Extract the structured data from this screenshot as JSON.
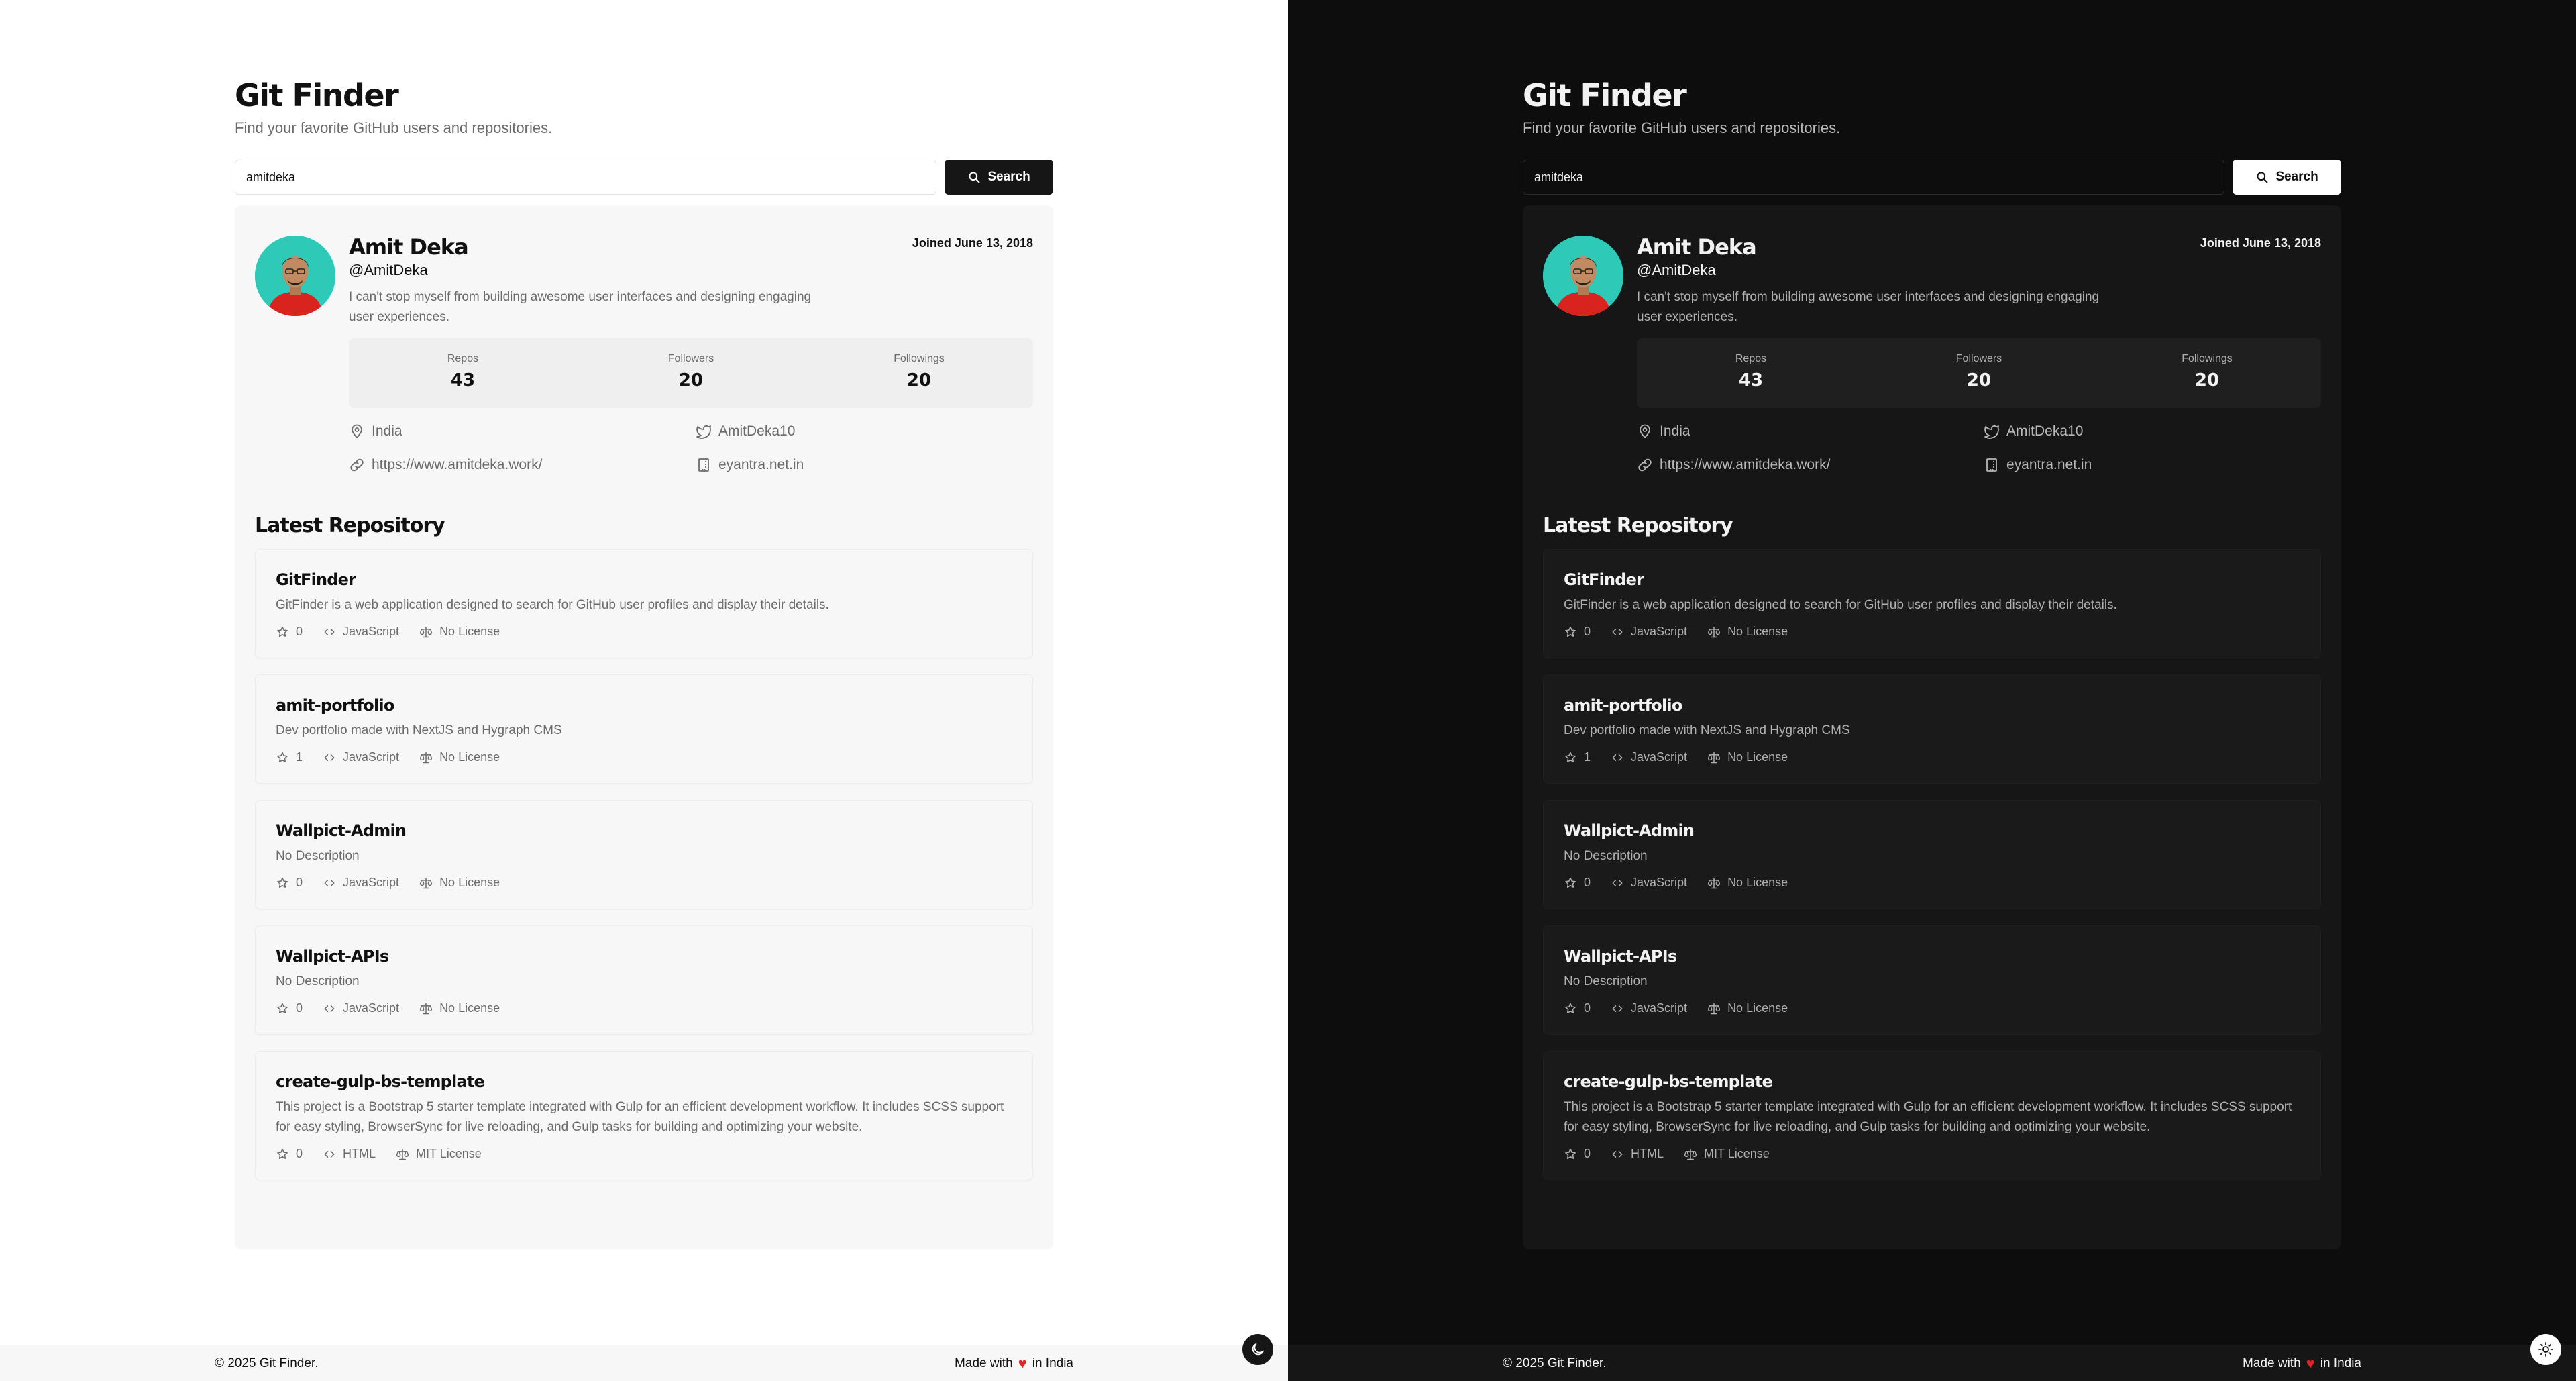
{
  "app": {
    "title": "Git Finder",
    "subtitle": "Find your favorite GitHub users and repositories."
  },
  "search": {
    "value": "amitdeka",
    "button_label": "Search",
    "icon": "search-icon"
  },
  "profile": {
    "name": "Amit Deka",
    "handle": "@AmitDeka",
    "bio": "I can't stop myself from building awesome user interfaces and designing engaging user experiences.",
    "joined": "Joined June 13, 2018",
    "stats": [
      {
        "label": "Repos",
        "value": "43"
      },
      {
        "label": "Followers",
        "value": "20"
      },
      {
        "label": "Followings",
        "value": "20"
      }
    ],
    "info": {
      "location": "India",
      "twitter": "AmitDeka10",
      "website": "https://www.amitdeka.work/",
      "company": "eyantra.net.in"
    }
  },
  "repos_section": {
    "title": "Latest Repository",
    "items": [
      {
        "name": "GitFinder",
        "description": "GitFinder is a web application designed to search for GitHub user profiles and display their details.",
        "stars": "0",
        "language": "JavaScript",
        "license": "No License"
      },
      {
        "name": "amit-portfolio",
        "description": "Dev portfolio made with NextJS and Hygraph CMS",
        "stars": "1",
        "language": "JavaScript",
        "license": "No License"
      },
      {
        "name": "Wallpict-Admin",
        "description": "No Description",
        "stars": "0",
        "language": "JavaScript",
        "license": "No License"
      },
      {
        "name": "Wallpict-APIs",
        "description": "No Description",
        "stars": "0",
        "language": "JavaScript",
        "license": "No License"
      },
      {
        "name": "create-gulp-bs-template",
        "description": "This project is a Bootstrap 5 starter template integrated with Gulp for an efficient development workflow. It includes SCSS support for easy styling, BrowserSync for live reloading, and Gulp tasks for building and optimizing your website.",
        "stars": "0",
        "language": "HTML",
        "license": "MIT License"
      }
    ]
  },
  "footer": {
    "copyright": "© 2025 Git Finder.",
    "made_with_prefix": "Made with",
    "made_with_suffix": "in India"
  },
  "colors": {
    "light_bg": "#ffffff",
    "dark_bg": "#0d0d0d",
    "heart": "#e02424",
    "avatar_bg": "#2fc9b7"
  },
  "themes": [
    "light",
    "dark"
  ]
}
